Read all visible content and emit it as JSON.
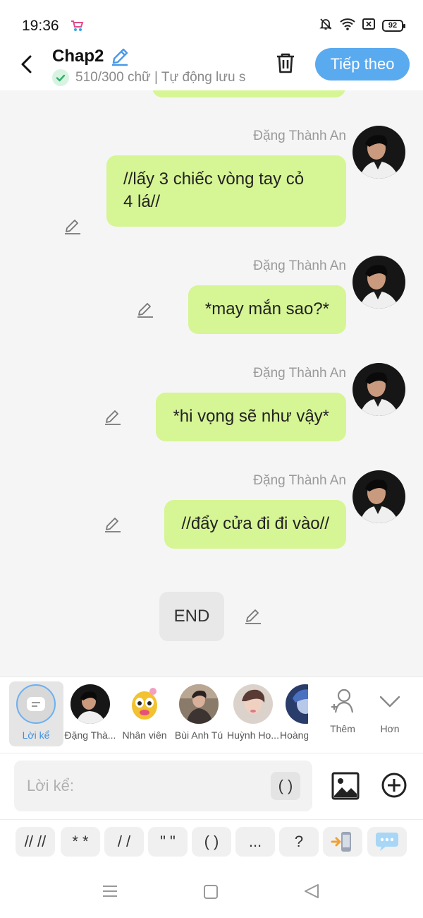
{
  "status_bar": {
    "time": "19:36",
    "battery": "92",
    "icons": [
      "shop-app-icon",
      "bell-off-icon",
      "wifi-icon",
      "notification-icon",
      "battery-icon"
    ]
  },
  "header": {
    "title": "Chap2",
    "subtitle": "510/300 chữ | Tự động lưu s",
    "next_label": "Tiếp theo"
  },
  "messages": [
    {
      "sender": "Đặng Thành An",
      "text_lines": [
        "//lấy 3 chiếc vòng tay cỏ",
        "4 lá//"
      ]
    },
    {
      "sender": "Đặng Thành An",
      "text_lines": [
        "*may mắn sao?*"
      ]
    },
    {
      "sender": "Đặng Thành An",
      "text_lines": [
        "*hi vọng sẽ như vậy*"
      ]
    },
    {
      "sender": "Đặng Thành An",
      "text_lines": [
        "//đẩy cửa đi đi vào//"
      ]
    }
  ],
  "end_label": "END",
  "characters": [
    {
      "label": "Lời kể",
      "selected": true
    },
    {
      "label": "Đặng Thà..."
    },
    {
      "label": "Nhân viên"
    },
    {
      "label": "Bùi Anh Tú"
    },
    {
      "label": "Huỳnh Ho..."
    },
    {
      "label": "Hoàng"
    }
  ],
  "char_actions": {
    "add_label": "Thêm",
    "more_label": "Hơn"
  },
  "input": {
    "placeholder": "Lời kể:",
    "paren_label": "( )"
  },
  "symbols": [
    "// //",
    "* *",
    "/ /",
    "\" \"",
    "( )",
    "...",
    "?"
  ],
  "colors": {
    "accent": "#5aaaf0",
    "bubble": "#d6f594",
    "selected_label": "#3d8fe0"
  }
}
